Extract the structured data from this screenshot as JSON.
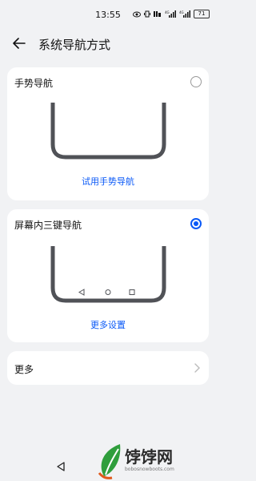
{
  "status": {
    "time": "13:55",
    "battery": "71",
    "signal_icons": [
      "eye-icon",
      "vibrate-icon",
      "volte-icon",
      "4g-signal-icon",
      "4g-signal-icon"
    ]
  },
  "header": {
    "title": "系统导航方式"
  },
  "gesture": {
    "title": "手势导航",
    "link": "试用手势导航",
    "selected": false
  },
  "three_key": {
    "title": "屏幕内三键导航",
    "link": "更多设置",
    "selected": true
  },
  "more": {
    "label": "更多"
  },
  "watermark": {
    "brand": "饽饽网",
    "url": "bobosnowboots.com"
  },
  "colors": {
    "accent": "#0a59f7",
    "background": "#f1f2f4",
    "card": "#ffffff"
  }
}
